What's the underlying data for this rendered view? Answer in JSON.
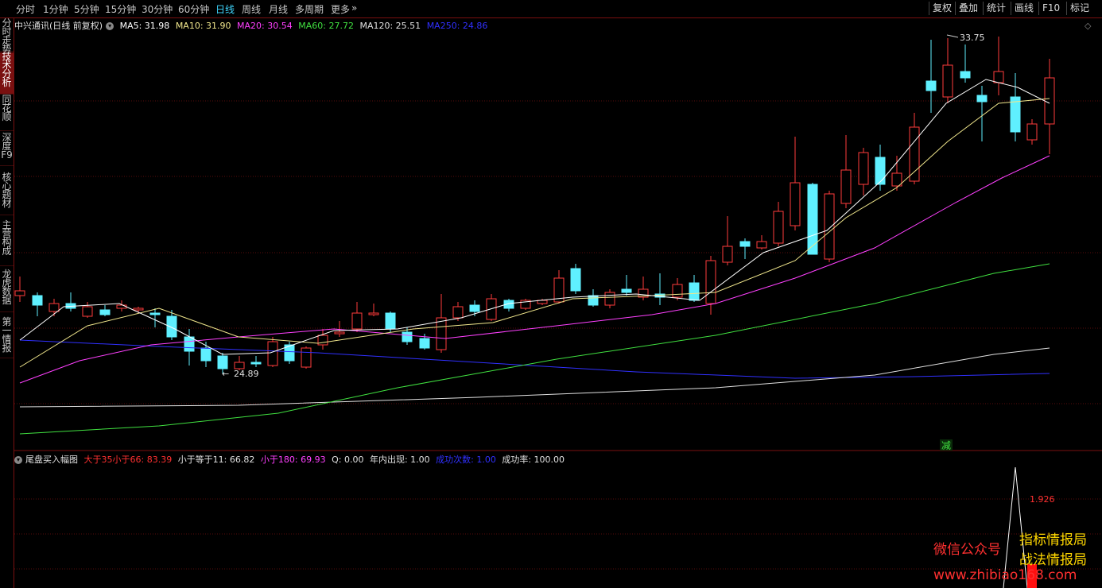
{
  "toolbar": {
    "periods": [
      "分时",
      "1分钟",
      "5分钟",
      "15分钟",
      "30分钟",
      "60分钟",
      "日线",
      "周线",
      "月线",
      "多周期",
      "更多"
    ],
    "active_period": "日线",
    "more_arrow": "»",
    "right_buttons": [
      "复权",
      "叠加",
      "统计",
      "画线",
      "F10",
      "标记"
    ],
    "diamond": "◇"
  },
  "sidebar": {
    "items": [
      "分时走势",
      "技术分析",
      "同花顺",
      "深度F9",
      "核心题材",
      "主营构成",
      "龙虎数据",
      "第一情报"
    ],
    "active": "技术分析"
  },
  "main_chart": {
    "stock_label": "中兴通讯(日线 前复权)",
    "ma": [
      {
        "label": "MA5: 31.98",
        "color": "#ffffff"
      },
      {
        "label": "MA10: 31.90",
        "color": "#f0e68c"
      },
      {
        "label": "MA20: 30.54",
        "color": "#ff40ff"
      },
      {
        "label": "MA60: 27.72",
        "color": "#40e040"
      },
      {
        "label": "MA120: 25.51",
        "color": "#e0e0e0"
      },
      {
        "label": "MA250: 24.86",
        "color": "#3030ff"
      }
    ],
    "high_label": "33.75",
    "low_label": "24.89",
    "minus_label": "减"
  },
  "indicator": {
    "name": "尾盘买入幅图",
    "items": [
      {
        "label": "大于35小于66: 83.39",
        "color": "#ff3030"
      },
      {
        "label": "小于等于11: 66.82",
        "color": "#e0e0e0"
      },
      {
        "label": "小于180: 69.93",
        "color": "#ff40ff"
      },
      {
        "label": "Q: 0.00",
        "color": "#e0e0e0"
      },
      {
        "label": "年内出现: 1.00",
        "color": "#e0e0e0"
      },
      {
        "label": "成功次数: 1.00",
        "color": "#3030ff"
      },
      {
        "label": "成功率: 100.00",
        "color": "#e0e0e0"
      }
    ],
    "peak_value": "1.926"
  },
  "watermark": {
    "line1_left": "微信公众号",
    "line1_right": "指标情报局",
    "line2": "战法情报局",
    "line3": "www.zhibiao168.com"
  }
}
